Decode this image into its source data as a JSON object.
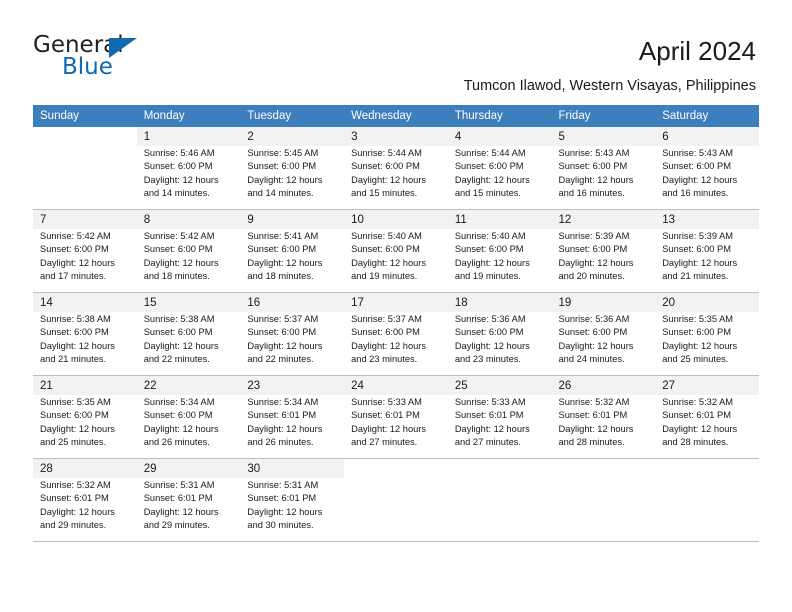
{
  "brand": {
    "name_part1": "General",
    "name_part2": "Blue",
    "triangle_color": "#1269b0"
  },
  "header": {
    "title": "April 2024",
    "subtitle": "Tumcon Ilawod, Western Visayas, Philippines"
  },
  "calendar": {
    "header_bg": "#3d7ebd",
    "weekdays": [
      "Sunday",
      "Monday",
      "Tuesday",
      "Wednesday",
      "Thursday",
      "Friday",
      "Saturday"
    ],
    "weeks": [
      [
        {
          "day": "",
          "info": ""
        },
        {
          "day": "1",
          "info": "Sunrise: 5:46 AM\nSunset: 6:00 PM\nDaylight: 12 hours\nand 14 minutes."
        },
        {
          "day": "2",
          "info": "Sunrise: 5:45 AM\nSunset: 6:00 PM\nDaylight: 12 hours\nand 14 minutes."
        },
        {
          "day": "3",
          "info": "Sunrise: 5:44 AM\nSunset: 6:00 PM\nDaylight: 12 hours\nand 15 minutes."
        },
        {
          "day": "4",
          "info": "Sunrise: 5:44 AM\nSunset: 6:00 PM\nDaylight: 12 hours\nand 15 minutes."
        },
        {
          "day": "5",
          "info": "Sunrise: 5:43 AM\nSunset: 6:00 PM\nDaylight: 12 hours\nand 16 minutes."
        },
        {
          "day": "6",
          "info": "Sunrise: 5:43 AM\nSunset: 6:00 PM\nDaylight: 12 hours\nand 16 minutes."
        }
      ],
      [
        {
          "day": "7",
          "info": "Sunrise: 5:42 AM\nSunset: 6:00 PM\nDaylight: 12 hours\nand 17 minutes."
        },
        {
          "day": "8",
          "info": "Sunrise: 5:42 AM\nSunset: 6:00 PM\nDaylight: 12 hours\nand 18 minutes."
        },
        {
          "day": "9",
          "info": "Sunrise: 5:41 AM\nSunset: 6:00 PM\nDaylight: 12 hours\nand 18 minutes."
        },
        {
          "day": "10",
          "info": "Sunrise: 5:40 AM\nSunset: 6:00 PM\nDaylight: 12 hours\nand 19 minutes."
        },
        {
          "day": "11",
          "info": "Sunrise: 5:40 AM\nSunset: 6:00 PM\nDaylight: 12 hours\nand 19 minutes."
        },
        {
          "day": "12",
          "info": "Sunrise: 5:39 AM\nSunset: 6:00 PM\nDaylight: 12 hours\nand 20 minutes."
        },
        {
          "day": "13",
          "info": "Sunrise: 5:39 AM\nSunset: 6:00 PM\nDaylight: 12 hours\nand 21 minutes."
        }
      ],
      [
        {
          "day": "14",
          "info": "Sunrise: 5:38 AM\nSunset: 6:00 PM\nDaylight: 12 hours\nand 21 minutes."
        },
        {
          "day": "15",
          "info": "Sunrise: 5:38 AM\nSunset: 6:00 PM\nDaylight: 12 hours\nand 22 minutes."
        },
        {
          "day": "16",
          "info": "Sunrise: 5:37 AM\nSunset: 6:00 PM\nDaylight: 12 hours\nand 22 minutes."
        },
        {
          "day": "17",
          "info": "Sunrise: 5:37 AM\nSunset: 6:00 PM\nDaylight: 12 hours\nand 23 minutes."
        },
        {
          "day": "18",
          "info": "Sunrise: 5:36 AM\nSunset: 6:00 PM\nDaylight: 12 hours\nand 23 minutes."
        },
        {
          "day": "19",
          "info": "Sunrise: 5:36 AM\nSunset: 6:00 PM\nDaylight: 12 hours\nand 24 minutes."
        },
        {
          "day": "20",
          "info": "Sunrise: 5:35 AM\nSunset: 6:00 PM\nDaylight: 12 hours\nand 25 minutes."
        }
      ],
      [
        {
          "day": "21",
          "info": "Sunrise: 5:35 AM\nSunset: 6:00 PM\nDaylight: 12 hours\nand 25 minutes."
        },
        {
          "day": "22",
          "info": "Sunrise: 5:34 AM\nSunset: 6:00 PM\nDaylight: 12 hours\nand 26 minutes."
        },
        {
          "day": "23",
          "info": "Sunrise: 5:34 AM\nSunset: 6:01 PM\nDaylight: 12 hours\nand 26 minutes."
        },
        {
          "day": "24",
          "info": "Sunrise: 5:33 AM\nSunset: 6:01 PM\nDaylight: 12 hours\nand 27 minutes."
        },
        {
          "day": "25",
          "info": "Sunrise: 5:33 AM\nSunset: 6:01 PM\nDaylight: 12 hours\nand 27 minutes."
        },
        {
          "day": "26",
          "info": "Sunrise: 5:32 AM\nSunset: 6:01 PM\nDaylight: 12 hours\nand 28 minutes."
        },
        {
          "day": "27",
          "info": "Sunrise: 5:32 AM\nSunset: 6:01 PM\nDaylight: 12 hours\nand 28 minutes."
        }
      ],
      [
        {
          "day": "28",
          "info": "Sunrise: 5:32 AM\nSunset: 6:01 PM\nDaylight: 12 hours\nand 29 minutes."
        },
        {
          "day": "29",
          "info": "Sunrise: 5:31 AM\nSunset: 6:01 PM\nDaylight: 12 hours\nand 29 minutes."
        },
        {
          "day": "30",
          "info": "Sunrise: 5:31 AM\nSunset: 6:01 PM\nDaylight: 12 hours\nand 30 minutes."
        },
        {
          "day": "",
          "info": ""
        },
        {
          "day": "",
          "info": ""
        },
        {
          "day": "",
          "info": ""
        },
        {
          "day": "",
          "info": ""
        }
      ]
    ]
  }
}
